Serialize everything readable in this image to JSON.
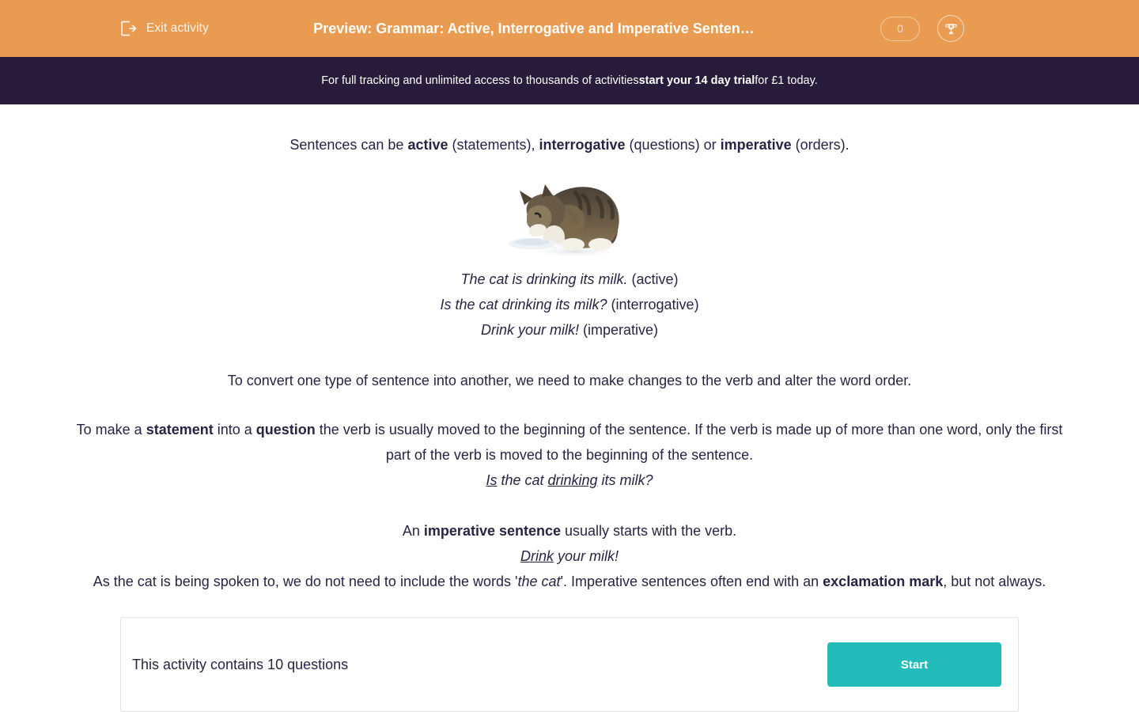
{
  "theme": {
    "header_bg": "#e89b51",
    "promo_bg": "#271c39",
    "accent_teal": "#23bcbb",
    "text": "#2a2344"
  },
  "header": {
    "exit_label": "Exit activity",
    "exit_icon": "exit-arrow-icon",
    "title": "Preview: Grammar: Active, Interrogative and Imperative Senten…",
    "score": "0",
    "trophy_icon": "trophy-icon"
  },
  "promo": {
    "text_before": "For full tracking and unlimited access to thousands of activities ",
    "text_bold": "start your 14 day trial",
    "text_after": " for £1 today."
  },
  "lesson": {
    "lead": {
      "p1": "Sentences can be ",
      "b1": "active",
      "p2": " (statements), ",
      "b2": "interrogative",
      "p3": " (questions) or ",
      "b3": "imperative",
      "p4": " (orders)."
    },
    "image_alt": "cat-drinking-milk-photo",
    "examples": [
      {
        "sentence": "The cat is drinking its milk.",
        "type": " (active)"
      },
      {
        "sentence": "Is the cat drinking its milk?",
        "type": " (interrogative)"
      },
      {
        "sentence": "Drink your milk!",
        "type": " (imperative)"
      }
    ],
    "convert_para": "To convert one type of sentence into another, we need to make changes to the verb and alter the word order.",
    "question_rule": {
      "s1": "To make a ",
      "b1": "statement",
      "s2": " into a ",
      "b2": "question",
      "s3": " the verb is usually moved to the beginning of the sentence. If the verb is made up of more than one word, only the first part of the verb is moved to the beginning of the sentence."
    },
    "question_example": {
      "u1": "Is",
      "mid": " the cat ",
      "u2": "drinking",
      "tail": " its milk?"
    },
    "imperative_rule": {
      "s1": "An ",
      "b1": "imperative sentence",
      "s2": " usually starts with the verb."
    },
    "imperative_example": {
      "u1": "Drink",
      "tail": " your milk!"
    },
    "imperative_note": {
      "s1": "As the cat is being spoken to, we do not need to include the words '",
      "i1": "the cat",
      "s2": "'. Imperative sentences often end with an ",
      "b1": "exclamation mark",
      "s3": ", but not always."
    }
  },
  "start_card": {
    "question_count_label": "This activity contains 10 questions",
    "start_label": "Start"
  }
}
